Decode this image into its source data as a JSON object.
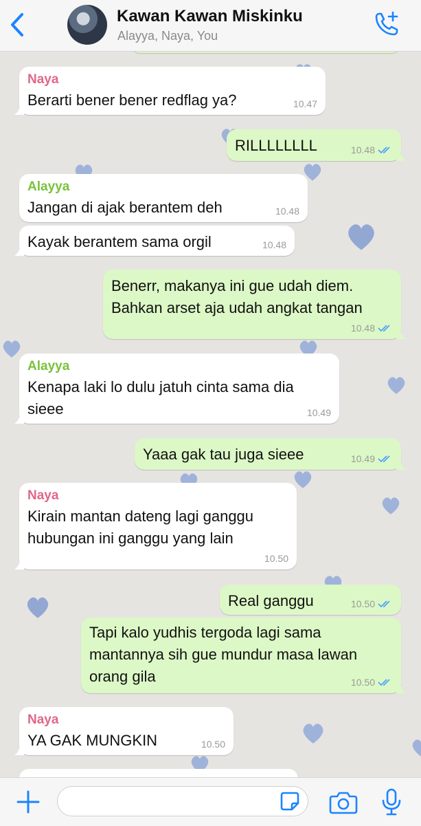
{
  "header": {
    "title": "Kawan Kawan Miskinku",
    "subtitle": "Alayya, Naya, You"
  },
  "colors": {
    "accent": "#1a84ff",
    "outgoing": "#dcf8c6",
    "naya": "#e0678a",
    "alayya": "#79c23c"
  },
  "messages": [
    {
      "direction": "in",
      "sender": "Naya",
      "text": "Berarti bener bener redflag ya?",
      "time": "10.47"
    },
    {
      "direction": "out",
      "text": "RILLLLLLLL",
      "time": "10.48",
      "status": "read"
    },
    {
      "direction": "in",
      "sender": "Alayya",
      "text": "Jangan di ajak berantem deh",
      "time": "10.48"
    },
    {
      "direction": "in",
      "text": "Kayak berantem sama orgil",
      "time": "10.48"
    },
    {
      "direction": "out",
      "lines": [
        "Benerr, makanya ini gue udah diem.",
        "Bahkan arset aja udah angkat tangan"
      ],
      "time": "10.48",
      "status": "read"
    },
    {
      "direction": "in",
      "sender": "Alayya",
      "lines": [
        "Kenapa laki lo dulu jatuh cinta sama dia",
        "sieee"
      ],
      "time": "10.49"
    },
    {
      "direction": "out",
      "text": "Yaaa gak tau juga sieee",
      "time": "10.49",
      "status": "read"
    },
    {
      "direction": "in",
      "sender": "Naya",
      "lines": [
        "Kirain mantan dateng lagi ganggu",
        "hubungan ini ganggu yang lain"
      ],
      "time": "10.50"
    },
    {
      "direction": "out",
      "text": "Real ganggu",
      "time": "10.50",
      "status": "read"
    },
    {
      "direction": "out",
      "lines": [
        "Tapi kalo yudhis tergoda lagi sama",
        "mantannya sih gue mundur masa lawan",
        "orang gila"
      ],
      "time": "10.50",
      "status": "read"
    },
    {
      "direction": "in",
      "sender": "Naya",
      "text": "YA GAK MUNGKIN",
      "time": "10.50"
    }
  ],
  "icons": {
    "back": "chevron-left-icon",
    "call": "add-call-icon",
    "attach": "plus-icon",
    "sticker": "sticker-icon",
    "camera": "camera-icon",
    "mic": "microphone-icon"
  }
}
